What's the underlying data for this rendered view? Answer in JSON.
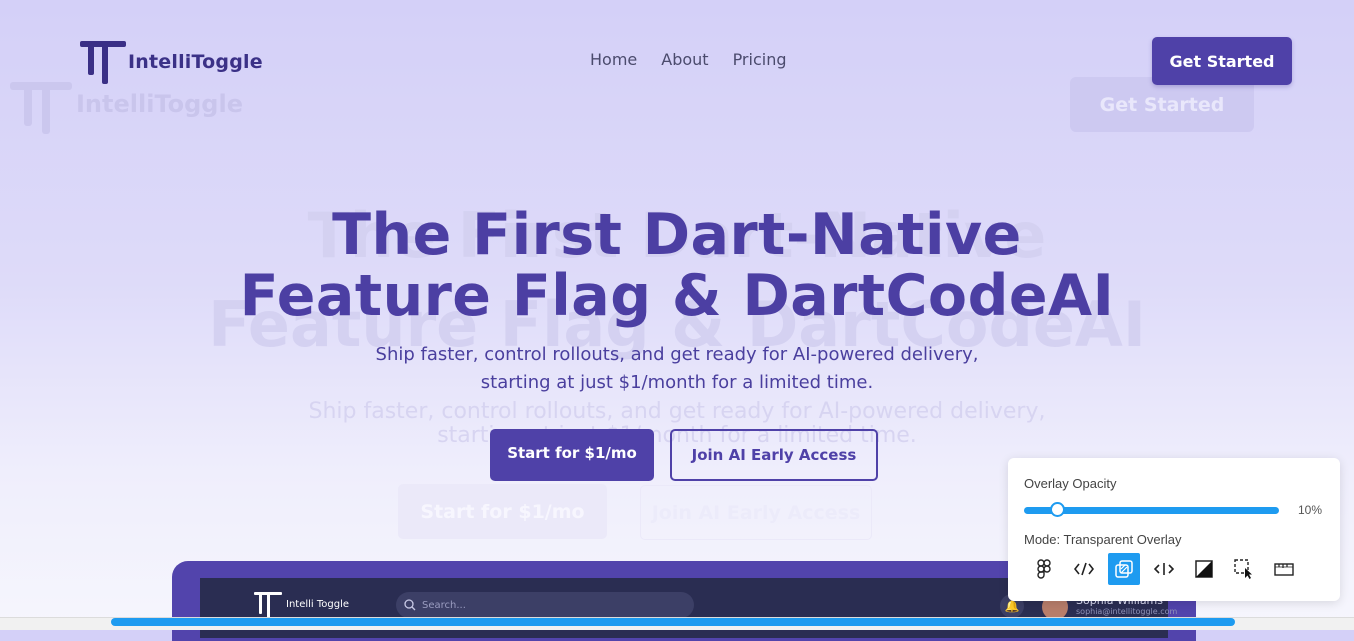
{
  "brand": {
    "name": "IntelliToggle",
    "accent": "#4f41a8",
    "overlay_accent": "#1e9bf0"
  },
  "nav": {
    "items": [
      "Home",
      "About",
      "Pricing"
    ],
    "cta": "Get Started"
  },
  "hero": {
    "title_line1": "The First Dart-Native",
    "title_line2": "Feature Flag & DartCodeAI",
    "subtitle_line1": "Ship faster, control rollouts, and get ready for AI-powered delivery,",
    "subtitle_line2": "starting at just $1/month for a limited time.",
    "primary_button": "Start for $1/mo",
    "secondary_button": "Join AI Early Access"
  },
  "ghost": {
    "logo": "IntelliToggle",
    "cta": "Get Started",
    "title_line1": "The First Dart-Native",
    "title_line2": "Feature Flag & DartCodeAI",
    "subtitle_line1": "Ship faster, control rollouts, and get ready for AI-powered delivery,",
    "subtitle_line2": "starting at just $1/month for a limited time.",
    "primary_button": "Start for $1/mo",
    "secondary_button": "Join AI Early Access"
  },
  "preview": {
    "logo": "Intelli Toggle",
    "search_placeholder": "Search...",
    "user_name": "Sophia Williams",
    "user_email": "sophia@intellitoggle.com"
  },
  "overlay_panel": {
    "opacity_label": "Overlay Opacity",
    "opacity_value_text": "10%",
    "opacity_value": 0.1,
    "mode_label": "Mode: Transparent Overlay",
    "tools": [
      "figma-icon",
      "code-icon",
      "overlay-icon",
      "split-icon",
      "difference-icon",
      "select-icon",
      "ruler-icon"
    ],
    "active_tool": "overlay-icon"
  }
}
